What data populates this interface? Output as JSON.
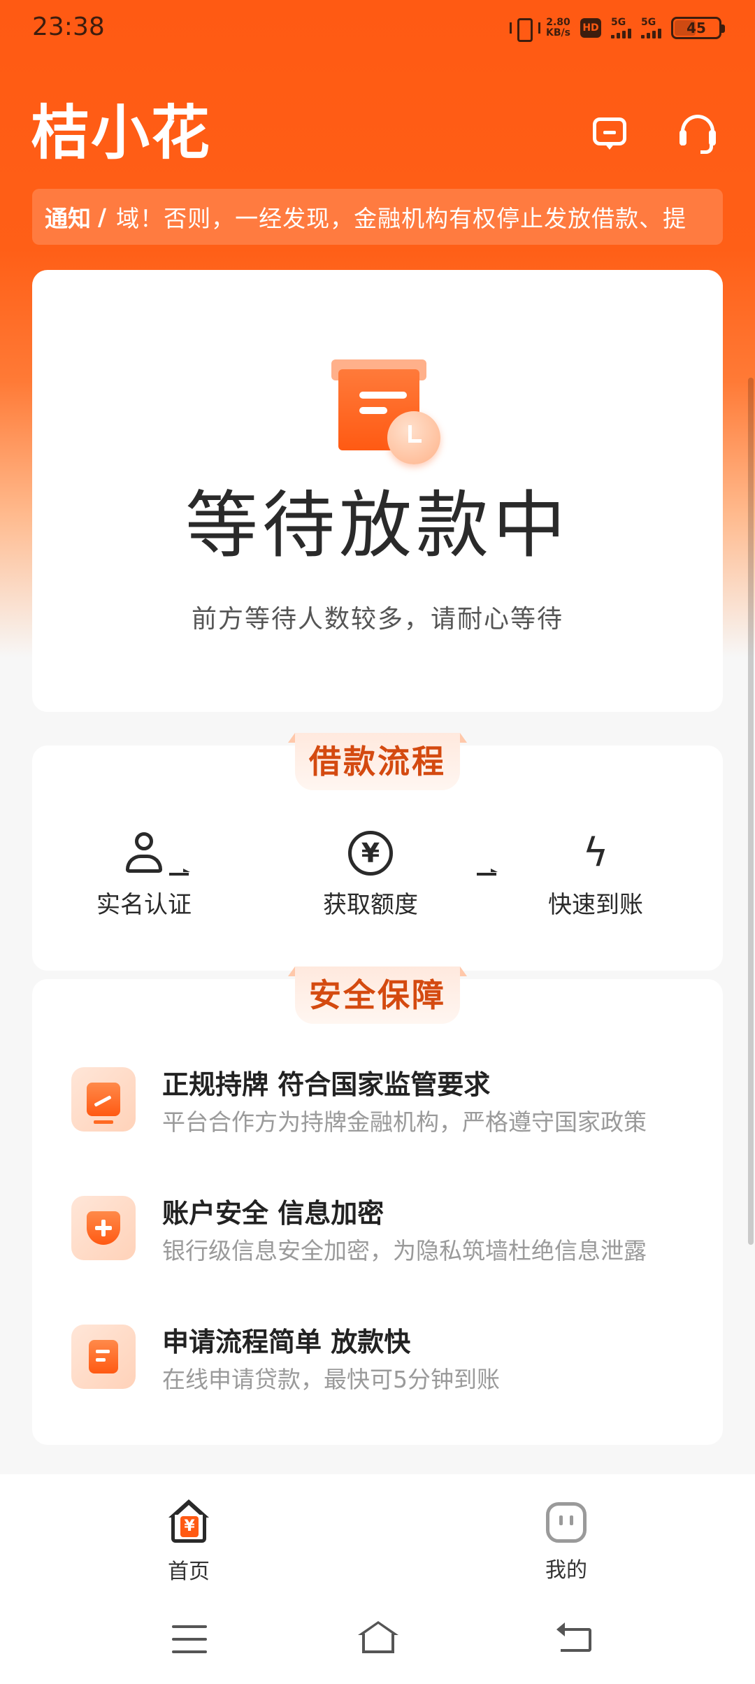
{
  "status_bar": {
    "time": "23:38",
    "net_speed_value": "2.80",
    "net_speed_unit": "KB/s",
    "hd_label": "HD",
    "sim1_label": "5G",
    "sim2_label": "5G",
    "battery_percent": "45",
    "battery_level": 0.45
  },
  "header": {
    "brand": "桔小花",
    "message_icon": "message-icon",
    "support_icon": "headset-icon"
  },
  "notice": {
    "label": "通知",
    "separator": "/",
    "text": "域！否则，一经发现，金融机构有权停止发放借款、提"
  },
  "status_card": {
    "icon": "waiting-document-icon",
    "title": "等待放款中",
    "subtitle": "前方等待人数较多，请耐心等待"
  },
  "process": {
    "title": "借款流程",
    "steps": [
      {
        "label": "实名认证",
        "icon": "person-icon"
      },
      {
        "label": "获取额度",
        "icon": "yen-coin-icon",
        "glyph": "¥"
      },
      {
        "label": "快速到账",
        "icon": "lightning-icon",
        "glyph": "ϟ"
      }
    ]
  },
  "security": {
    "title": "安全保障",
    "items": [
      {
        "title": "正规持牌 符合国家监管要求",
        "desc": "平台合作方为持牌金融机构，严格遵守国家政策",
        "icon": "monitor-chart-icon"
      },
      {
        "title": "账户安全 信息加密",
        "desc": "银行级信息安全加密，为隐私筑墙杜绝信息泄露",
        "icon": "shield-plus-icon"
      },
      {
        "title": "申请流程简单 放款快",
        "desc": "在线申请贷款，最快可5分钟到账",
        "icon": "document-icon"
      }
    ]
  },
  "bottom_nav": {
    "items": [
      {
        "label": "首页",
        "icon": "home-yen-icon",
        "glyph": "¥",
        "active": true
      },
      {
        "label": "我的",
        "icon": "profile-icon",
        "active": false
      }
    ]
  },
  "colors": {
    "brand_orange": "#ff5a13",
    "section_title": "#d44a10"
  }
}
